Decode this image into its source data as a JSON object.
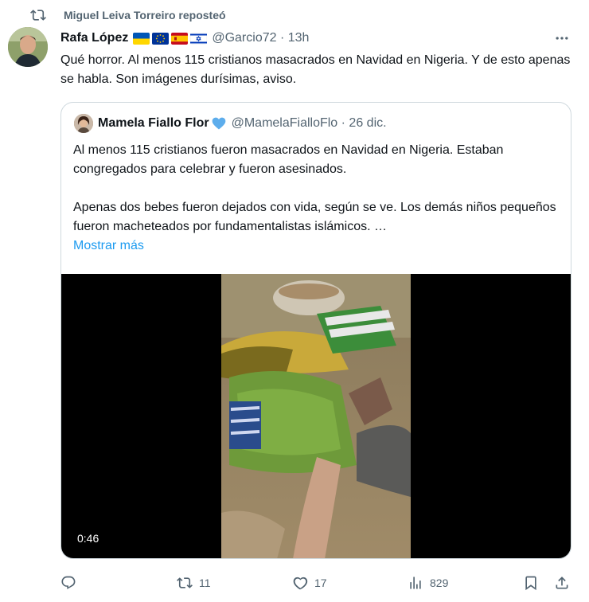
{
  "repost": {
    "icon": "repost-icon",
    "text": "Miguel Leiva Torreiro reposteó"
  },
  "tweet": {
    "author_name": "Rafa López",
    "flags": [
      "ukraine-flag",
      "eu-flag",
      "spain-flag",
      "israel-flag"
    ],
    "handle_time": "@Garcio72 · 13h",
    "more_icon": "more-icon",
    "text": "Qué horror. Al menos 115 cristianos masacrados en Navidad en Nigeria. Y de esto apenas se habla. Son imágenes durísimas, aviso."
  },
  "quote": {
    "author_name": "Mamela Fiallo Flor",
    "verified_icon": "blue-heart-icon",
    "handle_time": "@MamelaFialloFlo · 26 dic.",
    "para1": "Al menos 115 cristianos fueron masacrados en Navidad en Nigeria. Estaban congregados para celebrar y fueron asesinados.",
    "para2": "Apenas dos bebes fueron dejados con vida, según se ve. Los demás niños pequeños fueron macheteados por fundamentalistas islámicos. …",
    "show_more": "Mostrar más",
    "video_duration": "0:46"
  },
  "actions": {
    "reply": {
      "icon": "reply-icon",
      "count": ""
    },
    "retweet": {
      "icon": "retweet-icon",
      "count": "11"
    },
    "like": {
      "icon": "heart-icon",
      "count": "17"
    },
    "views": {
      "icon": "views-icon",
      "count": "829"
    },
    "bookmark": {
      "icon": "bookmark-icon"
    },
    "share": {
      "icon": "share-icon"
    }
  },
  "colors": {
    "text": "#0f1419",
    "secondary": "#536471",
    "link": "#1d9bf0",
    "border": "#cfd9de"
  }
}
